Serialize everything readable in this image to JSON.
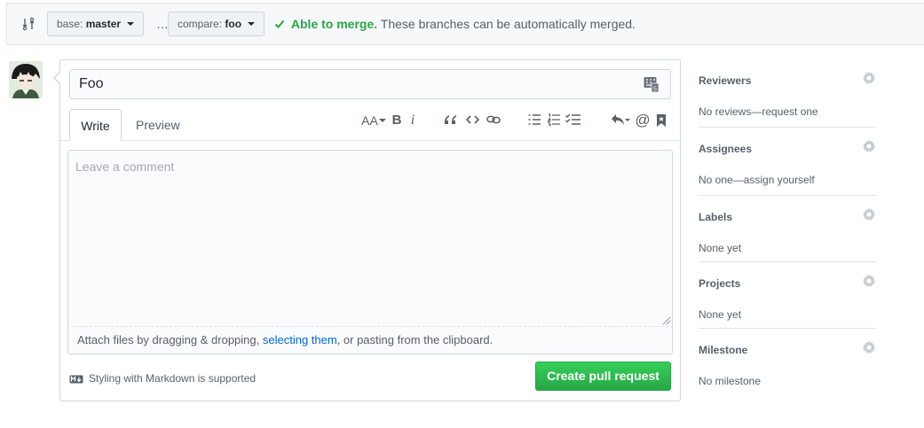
{
  "compare": {
    "base_prefix": "base:",
    "base_branch": "master",
    "separator": "…",
    "compare_prefix": "compare:",
    "compare_branch": "foo",
    "merge_status": "Able to merge.",
    "merge_message": "These branches can be automatically merged.",
    "status_color": "#28a745"
  },
  "form": {
    "title_value": "Foo",
    "tabs": {
      "write": "Write",
      "preview": "Preview"
    },
    "comment_placeholder": "Leave a comment",
    "attach": {
      "before": "Attach files by dragging & dropping, ",
      "link": "selecting them",
      "after": ", or pasting from the clipboard."
    },
    "markdown_note": "Styling with Markdown is supported",
    "submit_label": "Create pull request",
    "submit_color": "#28a745",
    "toolbar": {
      "heading": "AA",
      "bold": "B",
      "italic": "i",
      "mention": "@",
      "icons": [
        "text-size-icon",
        "bold-icon",
        "italic-icon",
        "quote-icon",
        "code-icon",
        "link-icon",
        "unordered-list-icon",
        "ordered-list-icon",
        "task-list-icon",
        "reply-icon",
        "mention-icon",
        "bookmark-icon"
      ]
    }
  },
  "sidebar": {
    "reviewers": {
      "heading": "Reviewers",
      "value": "No reviews—request one"
    },
    "assignees": {
      "heading": "Assignees",
      "value": "No one—assign yourself"
    },
    "labels": {
      "heading": "Labels",
      "value": "None yet"
    },
    "projects": {
      "heading": "Projects",
      "value": "None yet"
    },
    "milestone": {
      "heading": "Milestone",
      "value": "No milestone"
    }
  }
}
